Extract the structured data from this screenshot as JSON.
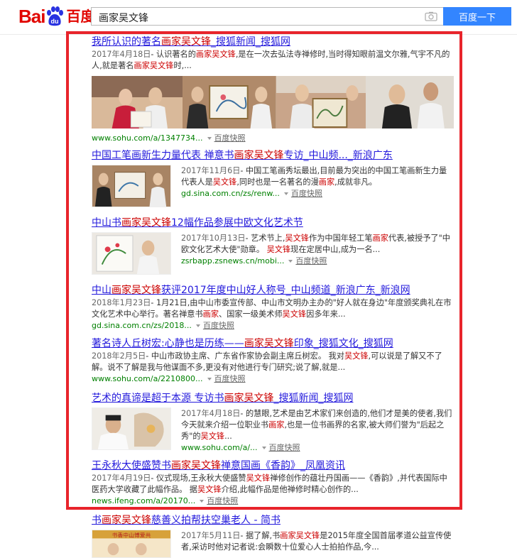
{
  "header": {
    "logo_bai": "Bai",
    "logo_du": "du",
    "logo_cn": "百度",
    "query": "画家吴文锋",
    "search_button": "百度一下"
  },
  "results": [
    {
      "title": [
        "我所认识的著名",
        "画家吴文锋",
        "_搜狐新闻_搜狐网"
      ],
      "date": "2017年4月18日",
      "abstract": [
        "- 认识著名的",
        "画家吴文锋",
        ",是在一次去弘法寺禅修时,当时得知眼前温文尔雅,气宇不凡的人,就是著名",
        "画家吴文锋",
        "时,..."
      ],
      "url": "www.sohu.com/a/1347734...",
      "cache": "百度快照"
    },
    {
      "title": [
        "中国工笔画新生力量代表 禅意书",
        "画家吴文锋",
        "专访_中山频..._新浪广东"
      ],
      "date": "2017年11月6日",
      "abstract": [
        "- 中国工笔画秀坛最出,目前最为突出的中国工笔画新生力量代表人是",
        "吴文锋",
        ",同时也是一名著名的漫",
        "画家",
        ",成就非凡。"
      ],
      "url": "gd.sina.com.cn/zs/renw...",
      "cache": "百度快照"
    },
    {
      "title": [
        "中山书",
        "画家吴文锋",
        "12幅作品参展中欧文化艺术节"
      ],
      "date": "2017年10月13日",
      "abstract": [
        "- 艺术节上,",
        "吴文锋",
        "作为中国年轻工笔",
        "画家",
        "代表,被授予了\"中欧文化艺术大使\"勋章。 ",
        "吴文锋",
        "现在定居中山,成为一名..."
      ],
      "url": "zsrbapp.zsnews.cn/mobi...",
      "cache": "百度快照"
    },
    {
      "title": [
        "中山",
        "画家吴文锋",
        "获评2017年度中山好人称号_中山频道_新浪广东_新浪网"
      ],
      "date": "2018年1月23日",
      "abstract": [
        "- 1月21日,由中山市委宣传部、中山市文明办主办的\"好人就在身边\"年度颁奖典礼在市文化艺术中心举行。著名禅意书",
        "画家",
        "、国家一级美术师",
        "吴文锋",
        "因多年来..."
      ],
      "url": "gd.sina.com.cn/zs/2018...",
      "cache": "百度快照"
    },
    {
      "title": [
        "著名诗人丘树宏:心静也是历练——",
        "画家吴文锋",
        "印象_搜狐文化_搜狐网"
      ],
      "date": "2018年2月5日",
      "abstract": [
        "- 中山市政协主席、广东省作家协会副主席丘树宏。 我对",
        "吴文锋",
        ",可以说是了解又不了解。说不了解是我与他谋面不多,更没有对他进行专门研究;说了解,就是..."
      ],
      "url": "www.sohu.com/a/2210800...",
      "cache": "百度快照"
    },
    {
      "title": [
        "艺术的真谛是超于本源 专访书",
        "画家吴文锋",
        "_搜狐新闻_搜狐网"
      ],
      "date": "2017年4月18日",
      "abstract": [
        "- 的慧眼,艺术是由艺术家们来创造的,他们才是美的使者,我们今天就来介绍一位职业书",
        "画家",
        ",也是一位书画界的名家,被大师们誉为\"后起之秀\"的",
        "吴文锋",
        "..."
      ],
      "url": "www.sohu.com/a/...",
      "cache": "百度快照"
    },
    {
      "title": [
        "王永秋大使盛赞书",
        "画家吴文锋",
        "禅意国画《香韵》_凤凰资讯"
      ],
      "date": "2017年4月19日",
      "abstract": [
        "- 仪式现场,王永秋大使盛赞",
        "吴文锋",
        "禅修创作的蕴壮丹国画——《香韵》,并代表国际中医药大学收藏了此幅作品。 据",
        "吴文锋",
        "介绍,此幅作品是他禅修时精心创作的..."
      ],
      "url": "news.ifeng.com/a/20170...",
      "cache": "百度快照"
    },
    {
      "title": [
        "书",
        "画家吴文锋",
        "慈善义拍帮扶空巢老人 - 简书"
      ],
      "date": "2017年5月11日",
      "abstract": [
        "- 据了解,书",
        "画家吴文锋",
        "是2015年度全国首届孝道公益宣传使者,采访时他对记者说:会瞬数十位爱心人士拍拍作品,今..."
      ],
      "thumb_caption": "书香中山博爱共",
      "url": "",
      "cache": ""
    }
  ]
}
